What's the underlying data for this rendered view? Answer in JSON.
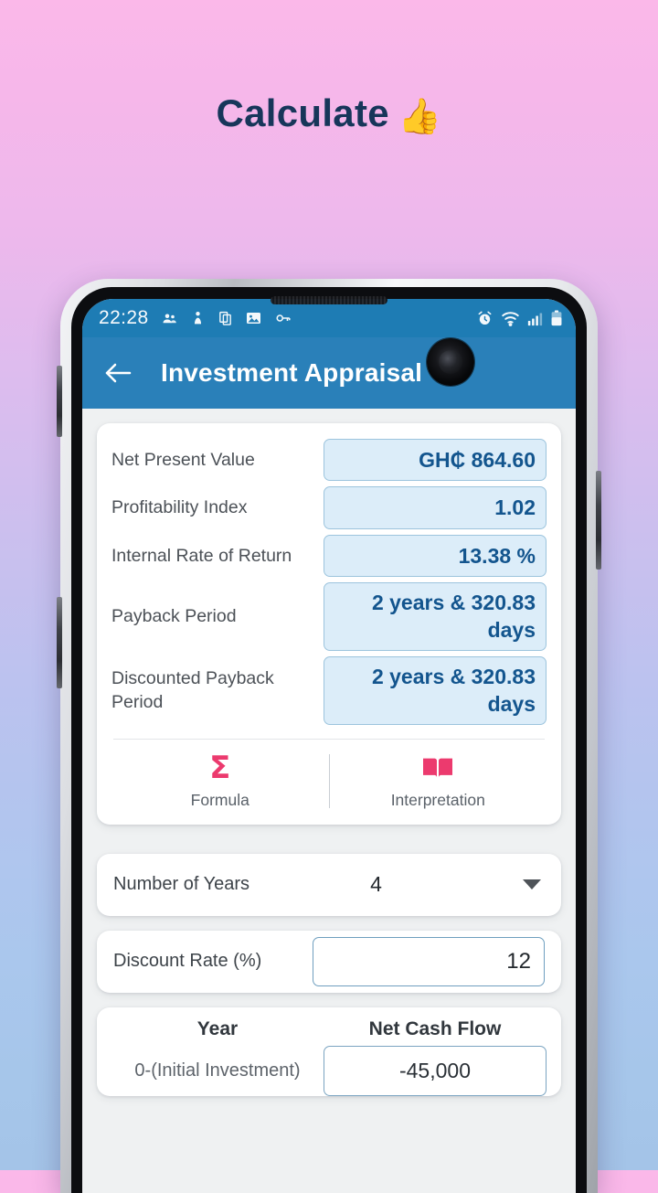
{
  "promo": {
    "heading": "Calculate",
    "emoji": "👍"
  },
  "status_bar": {
    "time": "22:28",
    "left_icons": [
      "contacts-icon",
      "person-icon",
      "copy-icon",
      "image-icon",
      "key-icon"
    ],
    "right_icons": [
      "alarm-icon",
      "wifi-icon",
      "signal-icon",
      "battery-icon"
    ]
  },
  "app_bar": {
    "back_icon": "back-arrow-icon",
    "title": "Investment Appraisal"
  },
  "results": {
    "rows": [
      {
        "label": "Net Present Value",
        "value": "GH₵ 864.60"
      },
      {
        "label": "Profitability Index",
        "value": "1.02"
      },
      {
        "label": "Internal Rate of Return",
        "value": "13.38 %"
      },
      {
        "label": "Payback Period",
        "value": "2 years & 320.83 days"
      },
      {
        "label": "Discounted Payback Period",
        "value": "2 years & 320.83 days"
      }
    ],
    "actions": [
      {
        "label": "Formula",
        "icon": "sigma-icon",
        "glyph": "Σ"
      },
      {
        "label": "Interpretation",
        "icon": "book-icon"
      }
    ]
  },
  "inputs": {
    "years": {
      "label": "Number of Years",
      "value": "4",
      "dropdown_icon": "chevron-down-icon"
    },
    "discount_rate": {
      "label": "Discount Rate (%)",
      "value": "12"
    }
  },
  "cashflow_table": {
    "headers": [
      "Year",
      "Net Cash Flow"
    ],
    "rows": [
      {
        "year": "0-(Initial Investment)",
        "flow": "-45,000"
      }
    ]
  },
  "colors": {
    "app_bar_blue": "#2a80b9",
    "status_blue": "#1e7cb4",
    "value_text": "#13558e",
    "value_bg": "#dcedf9",
    "accent_pink": "#ec3a6e",
    "heading_navy": "#17365a"
  }
}
